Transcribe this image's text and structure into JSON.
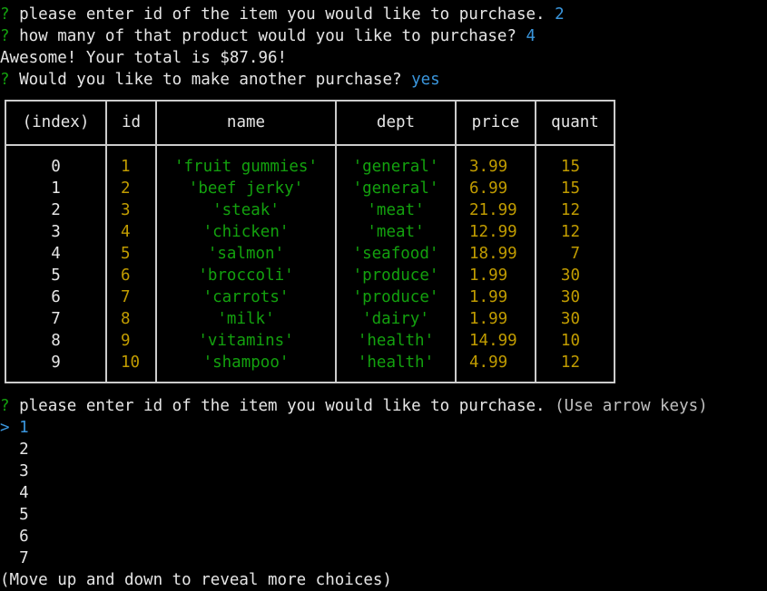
{
  "prompt_mark": "?",
  "history": {
    "q1": {
      "text": "please enter id of the item you would like to purchase.",
      "answer": "2"
    },
    "q2": {
      "text": "how many of that product would you like to purchase?",
      "answer": "4"
    },
    "total_line": "Awesome! Your total is $87.96!",
    "q3": {
      "text": "Would you like to make another purchase?",
      "answer": "yes"
    }
  },
  "table": {
    "headers": [
      "(index)",
      "id",
      "name",
      "dept",
      "price",
      "quant"
    ],
    "rows": [
      {
        "index": "0",
        "id": "1",
        "name": "'fruit gummies'",
        "dept": "'general'",
        "price": "3.99",
        "quant": "15"
      },
      {
        "index": "1",
        "id": "2",
        "name": "'beef jerky'",
        "dept": "'general'",
        "price": "6.99",
        "quant": "15"
      },
      {
        "index": "2",
        "id": "3",
        "name": "'steak'",
        "dept": "'meat'",
        "price": "21.99",
        "quant": "12"
      },
      {
        "index": "3",
        "id": "4",
        "name": "'chicken'",
        "dept": "'meat'",
        "price": "12.99",
        "quant": "12"
      },
      {
        "index": "4",
        "id": "5",
        "name": "'salmon'",
        "dept": "'seafood'",
        "price": "18.99",
        "quant": "7"
      },
      {
        "index": "5",
        "id": "6",
        "name": "'broccoli'",
        "dept": "'produce'",
        "price": "1.99",
        "quant": "30"
      },
      {
        "index": "6",
        "id": "7",
        "name": "'carrots'",
        "dept": "'produce'",
        "price": "1.99",
        "quant": "30"
      },
      {
        "index": "7",
        "id": "8",
        "name": "'milk'",
        "dept": "'dairy'",
        "price": "1.99",
        "quant": "30"
      },
      {
        "index": "8",
        "id": "9",
        "name": "'vitamins'",
        "dept": "'health'",
        "price": "14.99",
        "quant": "10"
      },
      {
        "index": "9",
        "id": "10",
        "name": "'shampoo'",
        "dept": "'health'",
        "price": "4.99",
        "quant": "12"
      }
    ]
  },
  "current_prompt": {
    "text": "please enter id of the item you would like to purchase.",
    "hint": "(Use arrow keys)",
    "pointer": ">",
    "choices": [
      "1",
      "2",
      "3",
      "4",
      "5",
      "6",
      "7"
    ],
    "footer": "(Move up and down to reveal more choices)"
  },
  "colors": {
    "prompt_mark": "#13a10e",
    "answer": "#3a96dd",
    "string": "#13a10e",
    "number": "#c19c00"
  }
}
